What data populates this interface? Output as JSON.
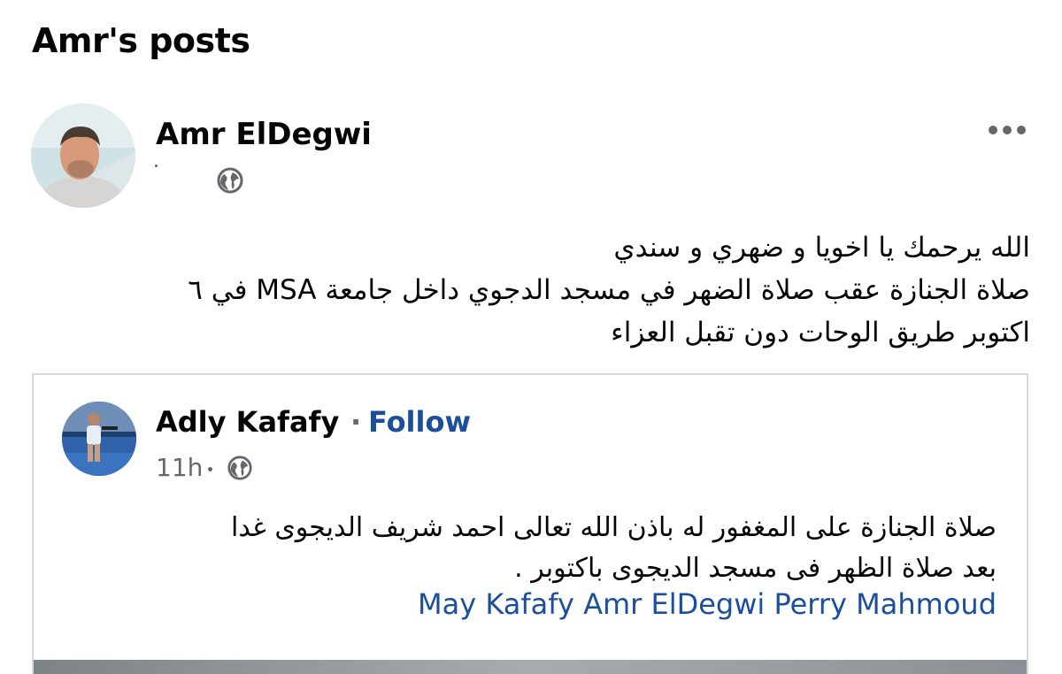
{
  "section_title": "Amr's posts",
  "post": {
    "author": "Amr ElDegwi",
    "body_lines": [
      "الله يرحمك يا اخويا و ضهري و سندي",
      "صلاة الجنازة  عقب صلاة الضهر في مسجد الدجوي داخل جامعة MSA في ٦",
      "اكتوبر طريق الوحات دون تقبل العزاء"
    ]
  },
  "shared_post": {
    "author": "Adly Kafafy",
    "separator": "·",
    "follow_label": "Follow",
    "time": "11h",
    "body_lines": [
      "صلاة الجنازة على المغفور له باذن الله تعالى احمد شريف الديجوى غدا",
      "بعد صلاة الظهر فى مسجد الديجوى باكتوبر ."
    ],
    "tags": [
      "May Kafafy",
      "Amr ElDegwi",
      "Perry Mahmoud"
    ]
  },
  "colors": {
    "link": "#1b4e9b",
    "secondary_text": "#65676b",
    "card_border": "#d6d8db"
  },
  "icons": [
    "globe-icon",
    "more-options-icon"
  ]
}
